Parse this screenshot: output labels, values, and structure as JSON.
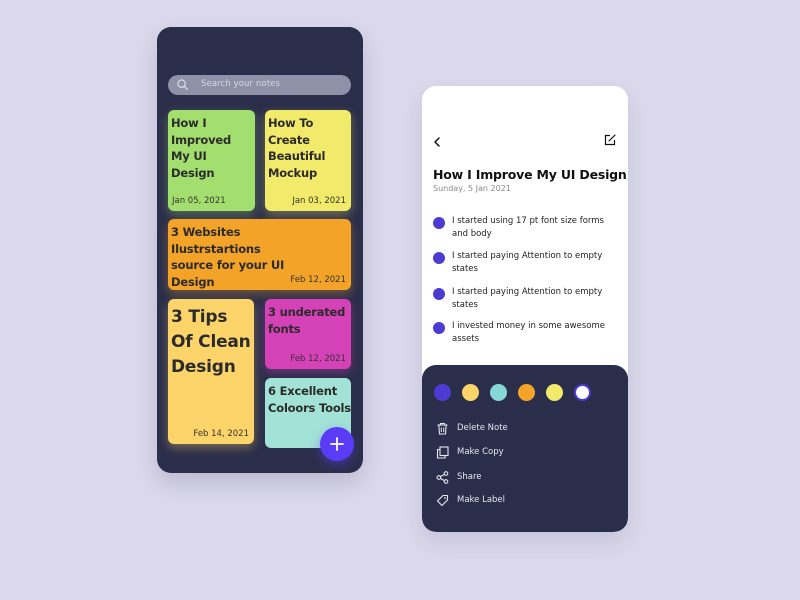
{
  "notes_list": {
    "search": {
      "placeholder": "Search your notes",
      "icon": "search-icon"
    },
    "notes": [
      {
        "title": "How I Improved My UI Design",
        "date": "Jan 05, 2021",
        "color": "#a3df6e"
      },
      {
        "title": "How To Create Beautiful Mockup",
        "date": "Jan 03, 2021",
        "color": "#f2ea6a"
      },
      {
        "title": "3 Websites Ilustrstartions source for your UI Design",
        "date": "Feb 12, 2021",
        "color": "#f4a329"
      },
      {
        "title": "3 Tips Of Clean Design",
        "date": "Feb 14, 2021",
        "color": "#fdd469"
      },
      {
        "title": "3 underated fonts",
        "date": "Feb 12, 2021",
        "color": "#d542b7"
      },
      {
        "title": "6 Excellent Coloors Tools",
        "date": "",
        "color": "#a3e2d6"
      }
    ],
    "fab_icon": "plus-icon"
  },
  "note_detail": {
    "title": "How I Improve My UI Design",
    "date": "Sunday, 5 Jan 2021",
    "bullets": [
      "I started using 17 pt font size forms and body",
      "I started paying Attention to empty states",
      "I started paying Attention to empty states",
      "I invested money in some awesome assets"
    ],
    "colors": [
      "#4b3bd1",
      "#fdd469",
      "#86d8d8",
      "#f4a329",
      "#f2ea6a",
      "#ffffff"
    ],
    "actions": [
      {
        "label": "Delete Note",
        "icon": "trash-icon"
      },
      {
        "label": "Make Copy",
        "icon": "copy-icon"
      },
      {
        "label": "Share",
        "icon": "share-icon"
      },
      {
        "label": "Make Label",
        "icon": "tag-icon"
      }
    ]
  }
}
